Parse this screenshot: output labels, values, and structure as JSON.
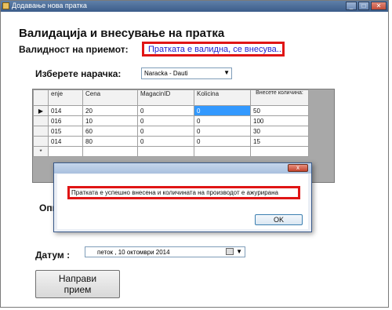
{
  "window": {
    "title": "Додавање нова пратка",
    "buttons": {
      "minimize": "_",
      "maximize": "□",
      "close": "✕"
    }
  },
  "form": {
    "heading": "Валидација и внесување на пратка",
    "validity_label": "Валидност на приемот:",
    "validity_message": "Пратката е валидна, се внесува..",
    "order_label": "Изберете нарачка:",
    "order_selected": "Naracka - Dauti",
    "partial_label": "Опи",
    "date_label": "Датум :",
    "date_value": "петок    , 10  октомври  2014",
    "receive_button": "Направи\nприем"
  },
  "grid": {
    "columns": [
      "enje",
      "Cena",
      "MagacinID",
      "Kolicina",
      "Внесете количина:"
    ],
    "rows": [
      {
        "indicator": "▶",
        "cells": [
          "014",
          "20",
          "0",
          "0",
          "50"
        ]
      },
      {
        "indicator": "",
        "cells": [
          "016",
          "10",
          "0",
          "0",
          "100"
        ]
      },
      {
        "indicator": "",
        "cells": [
          "015",
          "60",
          "0",
          "0",
          "30"
        ]
      },
      {
        "indicator": "",
        "cells": [
          "014",
          "80",
          "0",
          "0",
          "15"
        ]
      }
    ],
    "new_row_indicator": "*"
  },
  "dialog": {
    "message": "Пратката е успешно внесена и количината на производот е ажурирана",
    "ok_button": "OK",
    "close_glyph": "x"
  },
  "colors": {
    "highlight_border": "#e01515",
    "validity_text": "#2020d0",
    "selected_cell": "#3399ff"
  }
}
